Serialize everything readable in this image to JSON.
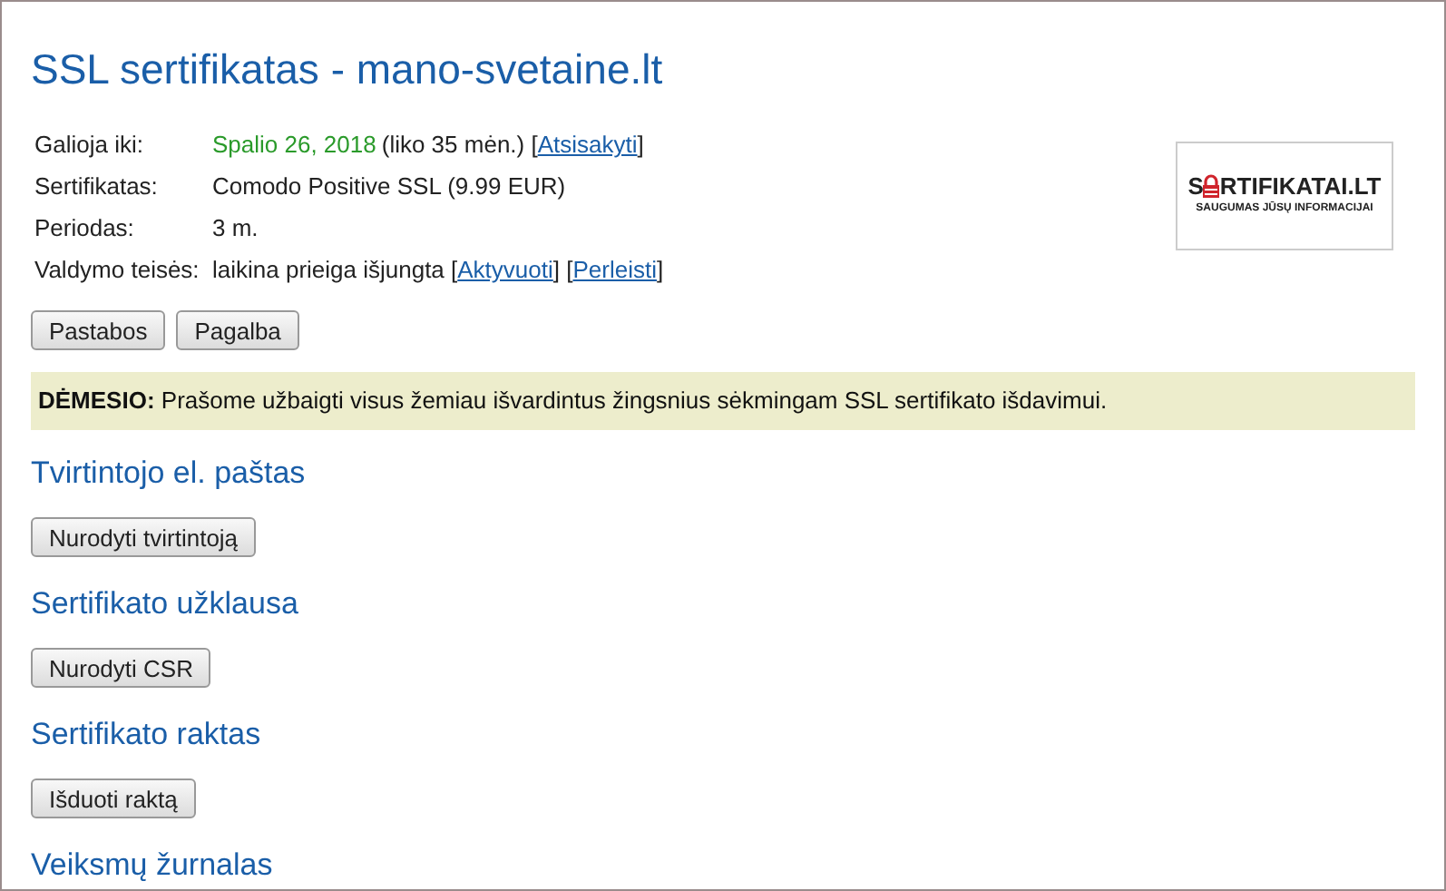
{
  "title": "SSL sertifikatas - mano-svetaine.lt",
  "details": [
    {
      "label": "Galioja iki:",
      "parts": [
        {
          "kind": "date",
          "text": "Spalio 26, 2018"
        },
        {
          "kind": "text",
          "text": "(liko 35 mėn.) ["
        },
        {
          "kind": "link",
          "text": "Atsisakyti"
        },
        {
          "kind": "text",
          "text": "]"
        }
      ]
    },
    {
      "label": "Sertifikatas:",
      "parts": [
        {
          "kind": "text",
          "text": "Comodo Positive SSL (9.99 EUR)"
        }
      ]
    },
    {
      "label": "Periodas:",
      "parts": [
        {
          "kind": "text",
          "text": "3 m."
        }
      ]
    },
    {
      "label": "Valdymo teisės:",
      "parts": [
        {
          "kind": "text",
          "text": "laikina prieiga išjungta ["
        },
        {
          "kind": "link",
          "text": "Aktyvuoti"
        },
        {
          "kind": "text",
          "text": "] ["
        },
        {
          "kind": "link",
          "text": "Perleisti"
        },
        {
          "kind": "text",
          "text": "]"
        }
      ]
    }
  ],
  "logo": {
    "brand_start": "S",
    "brand_end": "RTIFIKATAI.LT",
    "tagline": "SAUGUMAS JŪSŲ INFORMACIJAI"
  },
  "buttons": [
    "Pastabos",
    "Pagalba"
  ],
  "notice": "**DĖMESIO:** Prašome užbaigti visus žemiau išvardintus žingsnius sėkmingam SSL sertifikato išdavimui.",
  "sections": [
    {
      "heading": "Tvirtintojo el. paštas",
      "button": "Nurodyti tvirtintoją"
    },
    {
      "heading": "Sertifikato užklausa",
      "button": "Nurodyti CSR"
    },
    {
      "heading": "Sertifikato raktas",
      "button": "Išduoti raktą"
    },
    {
      "heading": "Veiksmų žurnalas"
    }
  ]
}
